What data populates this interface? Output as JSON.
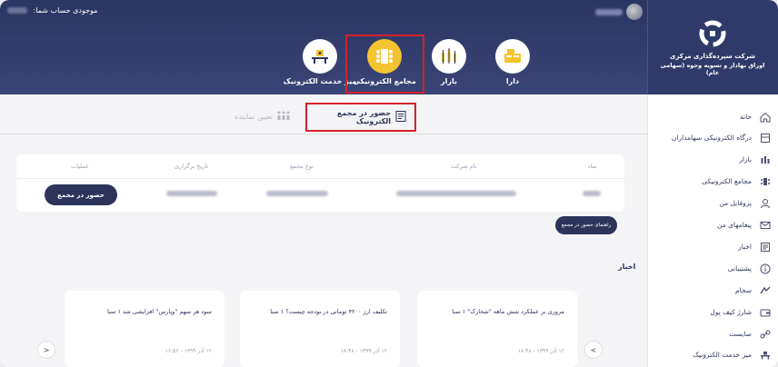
{
  "header": {
    "balance_label": "موجودی حساب شما:",
    "nav": [
      {
        "label": "دارا",
        "icon": "dara-icon"
      },
      {
        "label": "بازار",
        "icon": "market-icon"
      },
      {
        "label": "مجامع الکترونیکی",
        "icon": "assembly-icon"
      },
      {
        "label": "میز خدمت الکترونیک",
        "icon": "service-desk-icon"
      }
    ]
  },
  "brand": {
    "line1": "شرکت سپرده‌گذاری مرکزی",
    "line2": "اوراق بهادار و تسویه وجوه (سهامی عام)"
  },
  "sidebar": {
    "items": [
      {
        "label": "خانه",
        "icon": "home-icon"
      },
      {
        "label": "درگاه الکترونیکی سهامداران",
        "icon": "portal-icon"
      },
      {
        "label": "بازار",
        "icon": "market-icon"
      },
      {
        "label": "مجامع الکترونیکی",
        "icon": "assembly-icon"
      },
      {
        "label": "پروفایل من",
        "icon": "user-icon"
      },
      {
        "label": "پیغامهای من",
        "icon": "mail-icon"
      },
      {
        "label": "اخبار",
        "icon": "news-icon"
      },
      {
        "label": "پشتیبانی",
        "icon": "info-icon"
      },
      {
        "label": "سجام",
        "icon": "sejam-icon"
      },
      {
        "label": "شارژ کیف پول",
        "icon": "wallet-icon"
      },
      {
        "label": "صایست",
        "icon": "link-icon"
      },
      {
        "label": "میز خدمت الکترونیک",
        "icon": "service-desk-icon"
      }
    ]
  },
  "tabs": {
    "active": "حضور در مجمع الکترونیک",
    "inactive": "تعیین نماینده"
  },
  "table": {
    "headers": [
      "نماد",
      "نام شرکت",
      "نوع مجمع",
      "تاریخ برگزاری",
      "عملیات"
    ],
    "action_button": "حضور در مجمع"
  },
  "guide_button": "راهنمای حضور در مجمع",
  "news": {
    "title": "اخبار",
    "items": [
      {
        "text": "مروری بر عملکرد شش ماهه \"شخارک\" ۱ سنا",
        "date": "۱۲ آذر ۱۳۹۹ - ۱۸:۴۸"
      },
      {
        "text": "تکلیف ارز ۴۲۰۰ تومانی در بودجه چیست؟ ۱ سنا",
        "date": "۱۲ آذر ۱۳۹۹ - ۱۸:۴۸"
      },
      {
        "text": "سود هر سهم \"وپارس\" افزایشی شد ۱ سنا",
        "date": "۱۲ آذر ۱۳۹۹ - ۱۶:۵۶"
      }
    ],
    "prev": "<",
    "next": ">"
  }
}
